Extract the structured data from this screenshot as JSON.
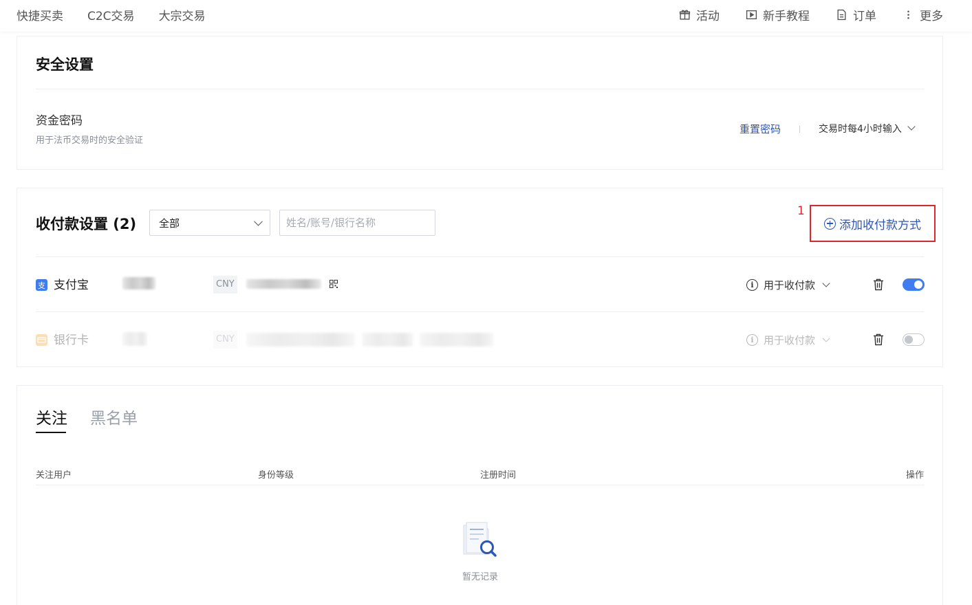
{
  "nav": {
    "left": [
      "快捷买卖",
      "C2C交易",
      "大宗交易"
    ],
    "right": [
      {
        "icon": "gift-icon",
        "label": "活动"
      },
      {
        "icon": "play-icon",
        "label": "新手教程"
      },
      {
        "icon": "document-icon",
        "label": "订单"
      },
      {
        "icon": "more-icon",
        "label": "更多"
      }
    ]
  },
  "security": {
    "title": "安全设置",
    "fund_password": "资金密码",
    "fund_password_desc": "用于法币交易时的安全验证",
    "reset_link": "重置密码",
    "input_policy": "交易时每4小时输入"
  },
  "payment": {
    "title": "收付款设置 (2)",
    "filter_selected": "全部",
    "search_placeholder": "姓名/账号/银行名称",
    "add_button": "添加收付款方式",
    "annotation": "1",
    "methods": [
      {
        "name": "支付宝",
        "currency": "CNY",
        "usage": "用于收付款",
        "enabled": true,
        "icon_color": "#3f7cf0"
      },
      {
        "name": "银行卡",
        "currency": "CNY",
        "usage": "用于收付款",
        "enabled": false,
        "icon_color": "#f2a23a"
      }
    ]
  },
  "follow": {
    "tabs": [
      "关注",
      "黑名单"
    ],
    "active_tab": "关注",
    "columns": [
      "关注用户",
      "身份等级",
      "注册时间",
      "操作"
    ],
    "empty_text": "暂无记录"
  },
  "colors": {
    "accent_blue": "#2f56b5",
    "toggle_on": "#3f7cf0",
    "annotation_red": "#e0242a"
  }
}
